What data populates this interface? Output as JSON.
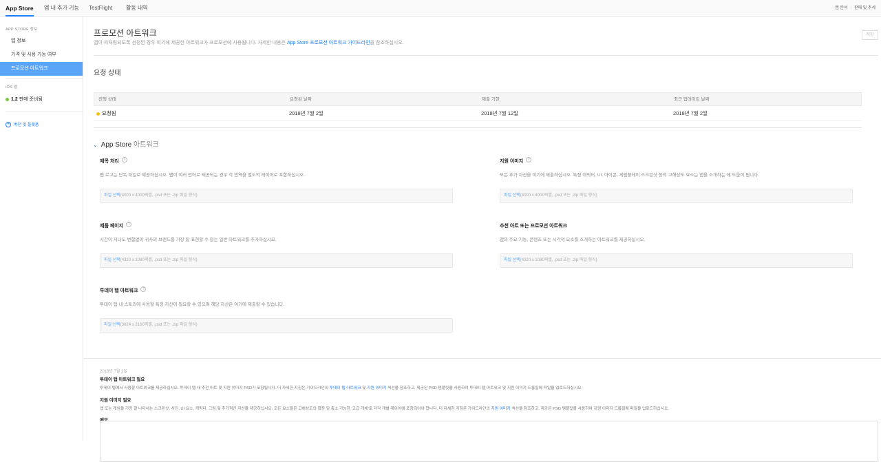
{
  "topbar": {
    "tabs": [
      "App Store",
      "앱 내 추가 기능",
      "TestFlight",
      "활동 내역"
    ],
    "right_links": [
      "앱 분석",
      "판매 및 추세"
    ]
  },
  "sidebar": {
    "section_header": "APP STORE 정보",
    "items": [
      "앱 정보",
      "가격 및 사용 가능 여부",
      "프로모션 아트워크"
    ],
    "ios_header": "iOS 앱",
    "ios_version": "1.2",
    "ios_status": "판매 준비됨",
    "add_label": "버전 및 플랫폼"
  },
  "main": {
    "title": "프로모션 아트워크",
    "desc_before": "앱이 피처링되도록 선정된 경우 여기에 제공한 아트워크가 프로모션에 사용됩니다. 자세한 내용은 ",
    "desc_link1": "App Store",
    "desc_link2": " 프로모션 아트워크 가이드라인",
    "desc_after": "을 참조하십시오.",
    "save_label": "저장",
    "request_status_title": "요청 상태",
    "table": {
      "headers": [
        "진행 상태",
        "요청된 날짜",
        "제출 기한",
        "최근 업데이트 날짜"
      ],
      "row": [
        "요청됨",
        "2018년 7월 2일",
        "2018년 7월 12일",
        "2018년 7월 2일"
      ]
    },
    "artwork_title_a": "App Store",
    "artwork_title_b": " 아트워크",
    "blocks": [
      {
        "label": "제목 처리",
        "desc": "앱 로고는 단독 파일로 제공하십시오. 앱이 여러 언어로 제공되는 경우 각 번역을 별도의 레이어로 포함하십시오.",
        "pick": "파일 선택",
        "spec": "(4000 x 4000픽셀, .psd 또는 .zip 파일 형식)"
      },
      {
        "label": "지원 이미지",
        "desc": "모든 추가 자산을 여기에 제출하십시오. 특정 캐릭터, UI, 아이콘, 게임플레이 스크린샷 등의 고해상도 요소는 앱을 소개하는 데 도움이 됩니다.",
        "pick": "파일 선택",
        "spec": "(4000 x 4000픽셀, .psd 또는 .zip 파일 형식)"
      },
      {
        "label": "제품 페이지",
        "desc": "시간이 지나도 변함없이 귀사의 브랜드를 가장 잘 표현할 수 있는 일반 아트워크를 추가하십시오.",
        "pick": "파일 선택",
        "spec": "(4320 x 1080픽셀, .psd 또는 .zip 파일 형식)"
      },
      {
        "label": "추천 아트 또는 프로모션 아트워크",
        "desc": "앱의 주요 기능, 콘텐츠 또는 시각적 요소를 소개하는 아트워크를 제공하십시오.",
        "pick": "파일 선택",
        "spec": "(4320 x 1080픽셀, .psd 또는 .zip 파일 형식)"
      },
      {
        "label": "투데이 탭 아트워크",
        "desc": "투데이 탭 내 스토리에 사용할 특정 자산이 필요할 수 있으며 해당 자산은 여기에 제출할 수 있습니다.",
        "pick": "파일 선택",
        "spec": "(3024 x 2160픽셀, .psd 또는 .zip 파일 형식)"
      }
    ],
    "notes": {
      "date": "2018년 7월 2일",
      "n1_title": "투데이 탭 아트워크 필요",
      "n1_a": "투데이 탭에서 사용할 아트워크를 제공하십시오. 투데이 탭 내 추천 아트 및 지원 이미지 PSD가 포함됩니다. 더 자세한 지침은 가이드라인의 ",
      "n1_link1": "투데이 탭 아트워크",
      "n1_b": " 및 ",
      "n1_link2": "지원 이미지",
      "n1_c": " 섹션을 참조하고, 제공된 PSD 템플릿을 사용하여 투데이 탭 아트워크 및 지원 이미지 드롭필에 파일을 업로드하십시오.",
      "n2_title": "지원 이미지 필요",
      "n2_a": "앱 또는 게임을 가장 잘 나타내는 스크린샷, 사진, UI 요소, 캐릭터, 그림 및 추가적인 자산을 제공하십시오. 모든 요소들은 고해상도의 확장 및 축소 가능한 '고급 개체'로 각각 개별 레이어에 포함되어야 합니다. 더 자세한 지침은 가이드라인의 ",
      "n2_link": "지원 이미지",
      "n2_b": " 섹션을 참조하고, 제공된 PSD 템플릿을 사용하여 지원 이미지 드롭필에 파일을 업로드하십시오.",
      "memo_label": "메모"
    }
  }
}
